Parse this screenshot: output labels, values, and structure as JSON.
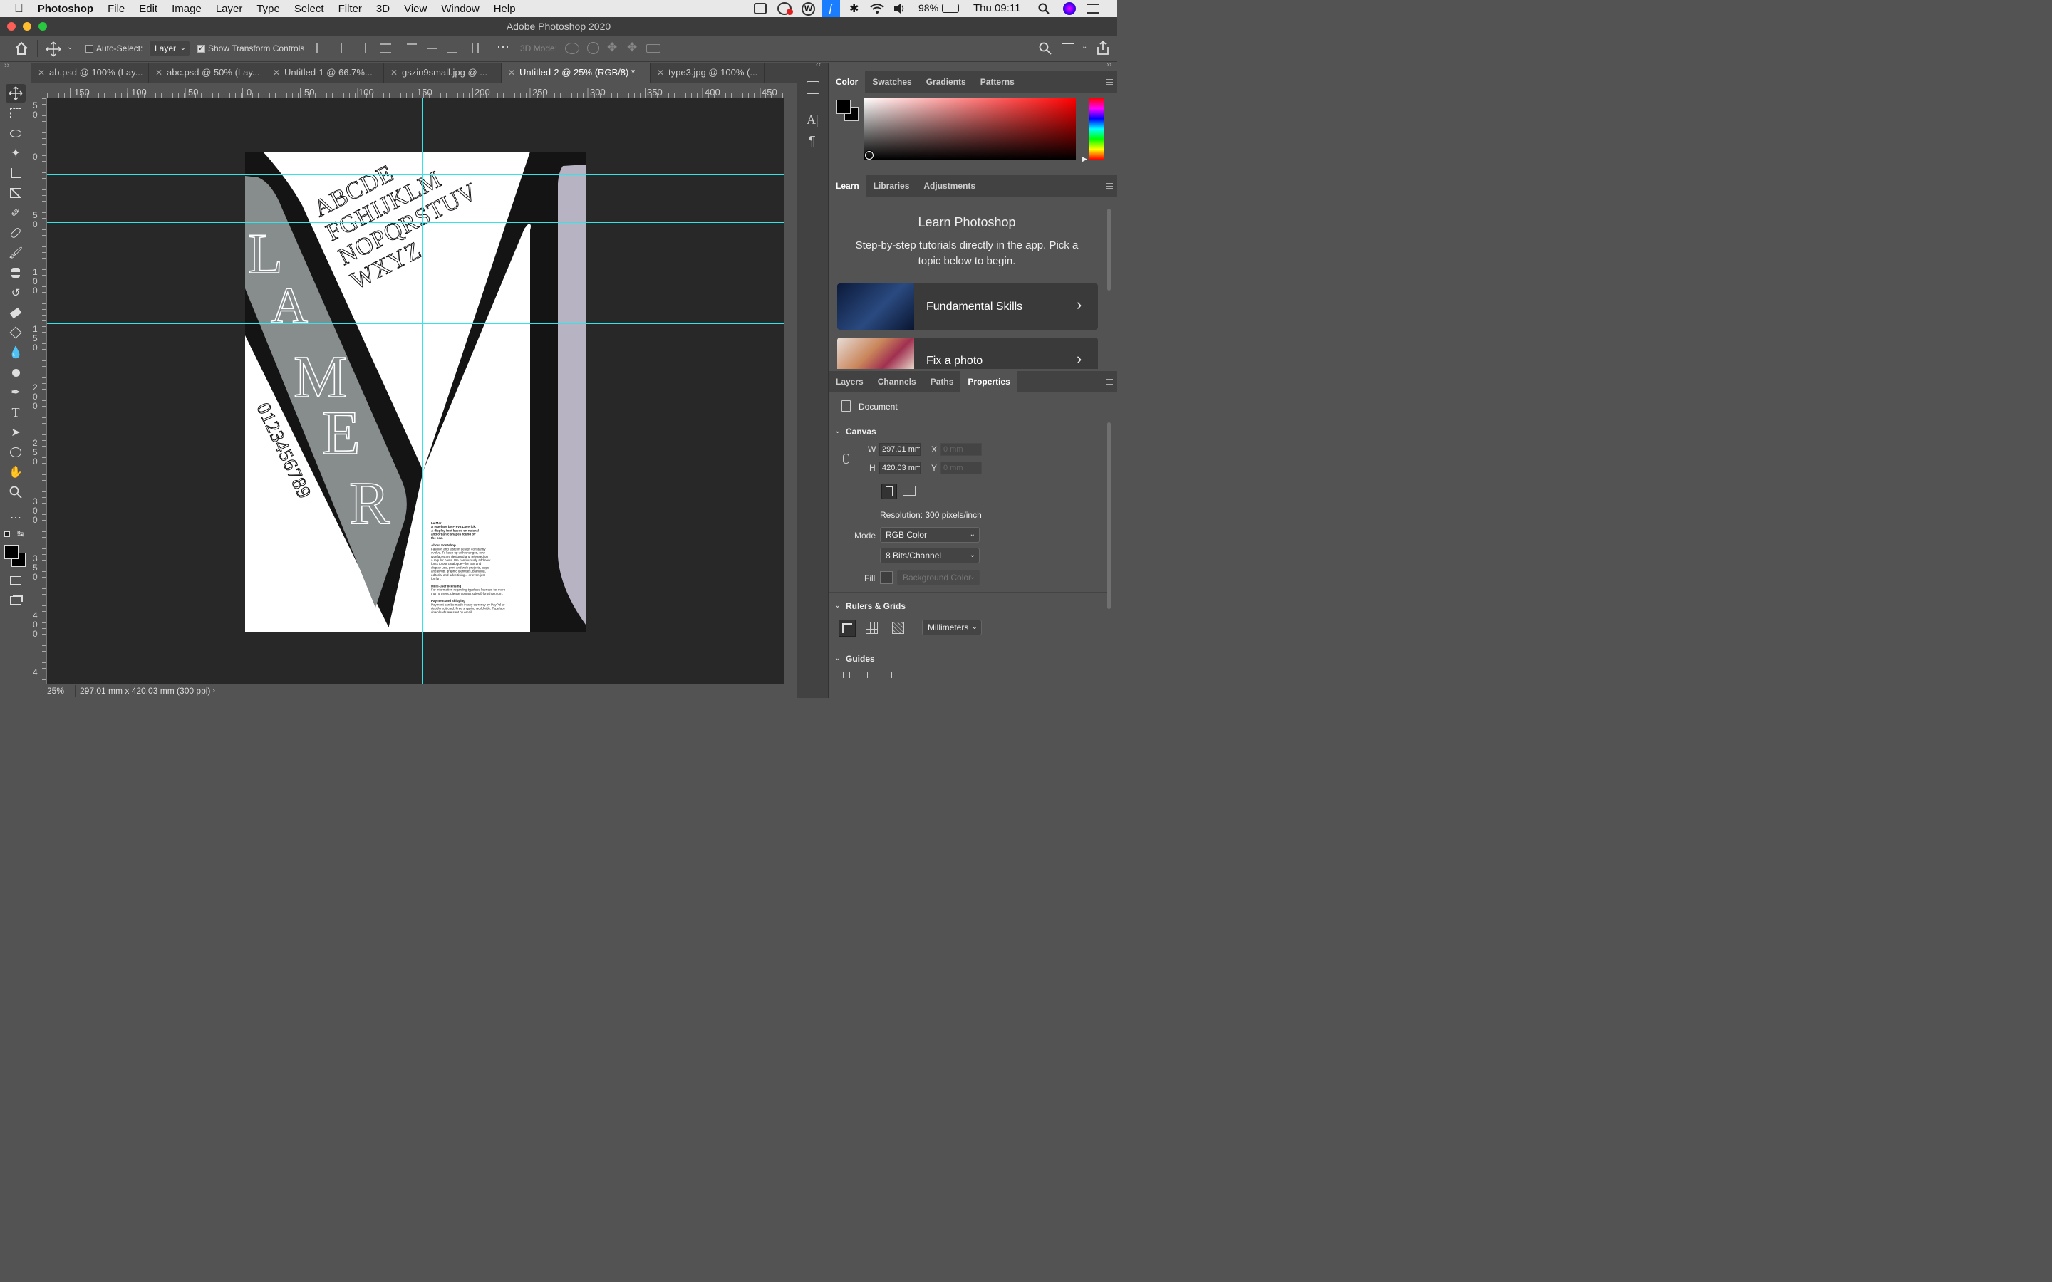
{
  "menubar": {
    "app": "Photoshop",
    "items": [
      "File",
      "Edit",
      "Image",
      "Layer",
      "Type",
      "Select",
      "Filter",
      "3D",
      "View",
      "Window",
      "Help"
    ],
    "battery": "98%",
    "clock": "Thu 09:11"
  },
  "window": {
    "title": "Adobe Photoshop 2020"
  },
  "options": {
    "auto_select_label": "Auto-Select:",
    "auto_select_checked": false,
    "auto_select_value": "Layer",
    "show_transform_label": "Show Transform Controls",
    "show_transform_checked": true,
    "mode3d_label": "3D Mode:"
  },
  "tabs": [
    {
      "label": "ab.psd @ 100% (Lay...",
      "active": false
    },
    {
      "label": "abc.psd @ 50% (Lay...",
      "active": false
    },
    {
      "label": "Untitled-1 @ 66.7%...",
      "active": false
    },
    {
      "label": "gszin9small.jpg @ ...",
      "active": false
    },
    {
      "label": "Untitled-2 @ 25% (RGB/8) *",
      "active": true
    },
    {
      "label": "type3.jpg @ 100% (...",
      "active": false
    }
  ],
  "ruler": {
    "top_ticks": [
      "150",
      "100",
      "50",
      "0",
      "50",
      "100",
      "150",
      "200",
      "250",
      "300",
      "350",
      "400",
      "450"
    ],
    "left_ticks": [
      "5\n0",
      "0",
      "5\n0",
      "1\n0\n0",
      "1\n5\n0",
      "2\n0\n0",
      "2\n5\n0",
      "3\n0\n0",
      "3\n5\n0",
      "4\n0\n0",
      "4"
    ]
  },
  "artwork": {
    "alphabet": [
      "ABCDE",
      "FGHIJKLM",
      "NOPQRSTUV",
      "WXYZ"
    ],
    "title_letters": [
      "L",
      "A",
      "M",
      "E",
      "R"
    ],
    "numbers": "0123456789",
    "small_text": [
      {
        "t": "La Mer",
        "b": true
      },
      {
        "t": "A typeface by Freya Laverick.",
        "b": true
      },
      {
        "t": "A display font based on natural",
        "b": true
      },
      {
        "t": "and organic shapes found by",
        "b": true
      },
      {
        "t": "the sea.",
        "b": true
      },
      {
        "t": "",
        "b": false
      },
      {
        "t": "About Fontshop",
        "b": true
      },
      {
        "t": "Fashion and taste in design constantly",
        "b": false
      },
      {
        "t": "evolve. To keep up with changes, new",
        "b": false
      },
      {
        "t": "typefaces are designed and released on",
        "b": false
      },
      {
        "t": "a regular basis. We continuously add new",
        "b": false
      },
      {
        "t": "fonts to our catalogue—for text and",
        "b": false
      },
      {
        "t": "display use, print and web projects, apps",
        "b": false
      },
      {
        "t": "and ePub, graphic identities, branding,",
        "b": false
      },
      {
        "t": "editorial and advertising... or even just",
        "b": false
      },
      {
        "t": "for fun.",
        "b": false
      },
      {
        "t": "",
        "b": false
      },
      {
        "t": "Multi-user licensing",
        "b": true
      },
      {
        "t": "For information regarding typeface licences for more",
        "b": false
      },
      {
        "t": "than 5 users, please contact sales@fontshop.com.",
        "b": false
      },
      {
        "t": "",
        "b": false
      },
      {
        "t": "Payment and shipping",
        "b": true
      },
      {
        "t": "Payment can be made in any currency by PayPal or",
        "b": false
      },
      {
        "t": "debit/credit card. Free shipping worldwide. Typeface",
        "b": false
      },
      {
        "t": "downloads are sent by email.",
        "b": false
      }
    ]
  },
  "status": {
    "zoom": "25%",
    "doc_size": "297.01 mm x 420.03 mm (300 ppi)"
  },
  "color_panel": {
    "tabs": [
      "Color",
      "Swatches",
      "Gradients",
      "Patterns"
    ],
    "active": "Color",
    "hue": "#ff0000"
  },
  "learn_panel": {
    "tabs": [
      "Learn",
      "Libraries",
      "Adjustments"
    ],
    "title": "Learn Photoshop",
    "description": "Step-by-step tutorials directly in the app. Pick a topic below to begin.",
    "cards": [
      "Fundamental Skills",
      "Fix a photo"
    ]
  },
  "props_panel": {
    "tabs": [
      "Layers",
      "Channels",
      "Paths",
      "Properties"
    ],
    "active": "Properties",
    "doc_label": "Document",
    "canvas_header": "Canvas",
    "w_label": "W",
    "w_value": "297.01 mm",
    "h_label": "H",
    "h_value": "420.03 mm",
    "x_label": "X",
    "x_placeholder": "0 mm",
    "y_label": "Y",
    "y_placeholder": "0 mm",
    "resolution": "Resolution: 300 pixels/inch",
    "mode_label": "Mode",
    "mode_value": "RGB Color",
    "bits_value": "8 Bits/Channel",
    "fill_label": "Fill",
    "fill_value": "Background Color",
    "rulers_header": "Rulers & Grids",
    "units_value": "Millimeters",
    "guides_header": "Guides"
  },
  "colors": {
    "guide": "#35e4e8",
    "poster_black": "#141414",
    "poster_grey": "#878c8d",
    "poster_lilac": "#b7b3c2"
  }
}
